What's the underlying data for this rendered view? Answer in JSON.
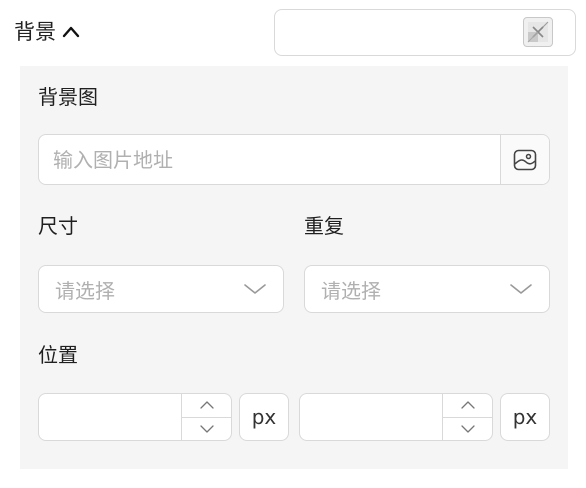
{
  "header": {
    "title": "背景",
    "toggle_icon": "chevron-up-icon",
    "clear_icon": "clear-color-icon"
  },
  "background_image": {
    "label": "背景图",
    "placeholder": "输入图片地址",
    "value": "",
    "picker_icon": "image-icon"
  },
  "size": {
    "label": "尺寸",
    "placeholder": "请选择",
    "icon": "chevron-down-icon"
  },
  "repeat": {
    "label": "重复",
    "placeholder": "请选择",
    "icon": "chevron-down-icon"
  },
  "position": {
    "label": "位置",
    "x": {
      "value": "",
      "unit": "px"
    },
    "y": {
      "value": "",
      "unit": "px"
    }
  },
  "colors": {
    "panel_bg": "#f5f5f5",
    "border": "#d9d9d9",
    "placeholder": "#b0b0b0"
  }
}
